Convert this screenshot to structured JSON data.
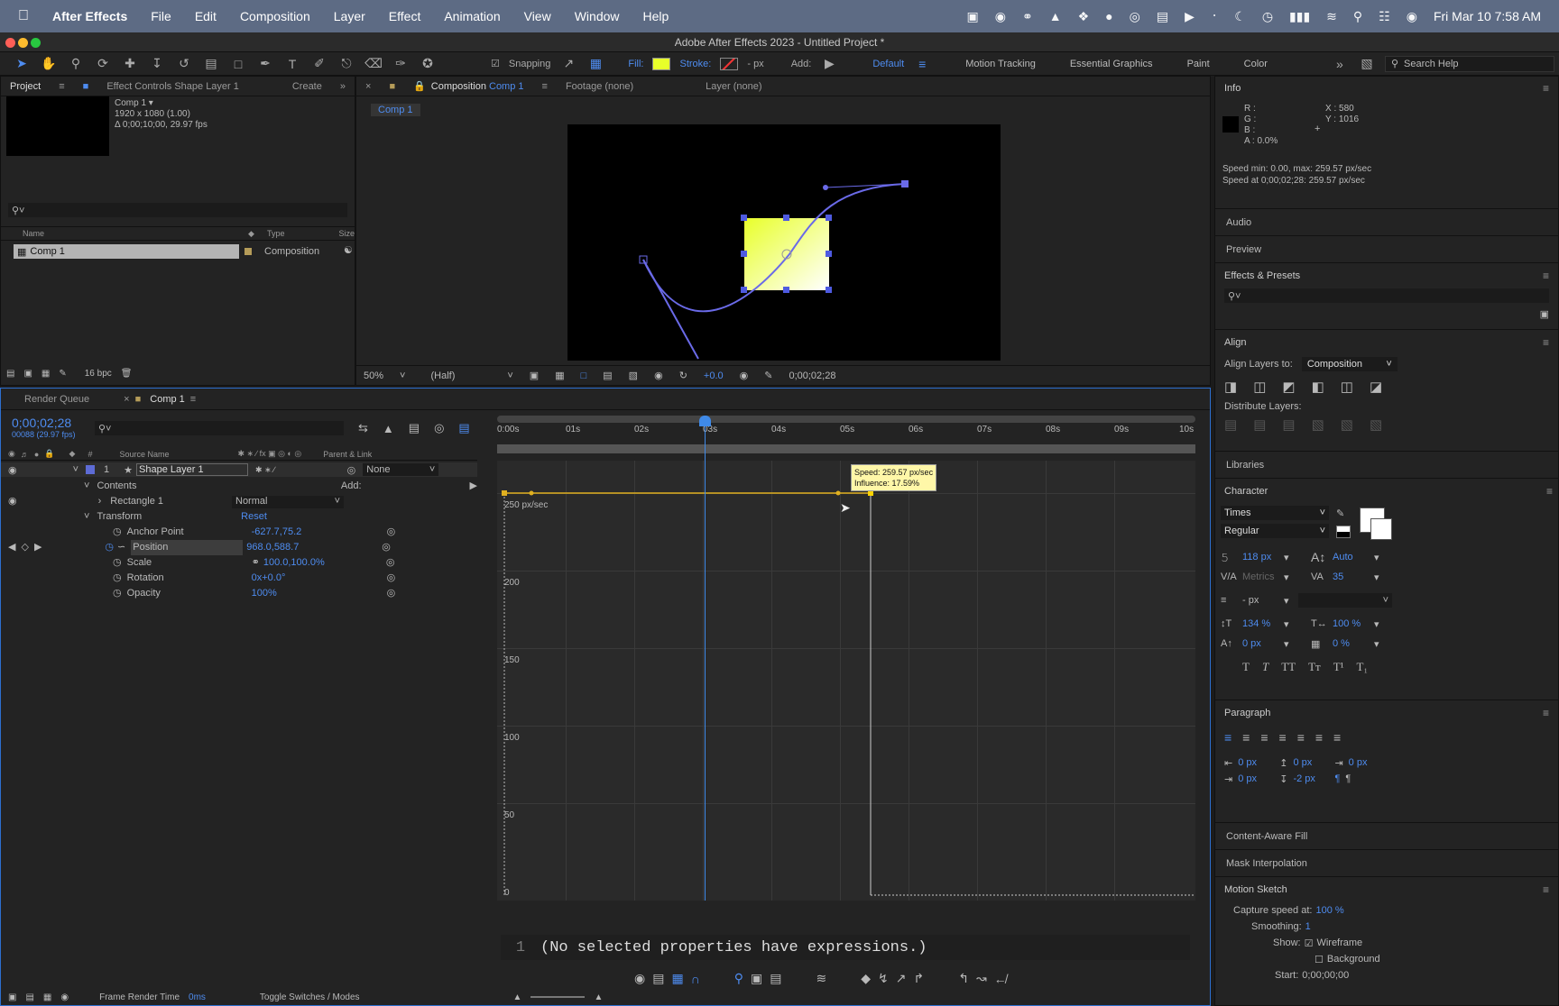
{
  "menubar": {
    "app": "After Effects",
    "items": [
      "File",
      "Edit",
      "Composition",
      "Layer",
      "Effect",
      "Animation",
      "View",
      "Window",
      "Help"
    ],
    "datetime": "Fri Mar 10  7:58 AM"
  },
  "window": {
    "title": "Adobe After Effects 2023 - Untitled Project *"
  },
  "toolbar": {
    "snapping": "Snapping",
    "fill": "Fill:",
    "stroke": "Stroke:",
    "px": "- px",
    "add": "Add:",
    "workspaces": [
      "Default",
      "Motion Tracking",
      "Essential Graphics",
      "Paint",
      "Color"
    ],
    "search_placeholder": "Search Help"
  },
  "project": {
    "tab": "Project",
    "effect_controls": "Effect Controls Shape Layer 1",
    "create": "Create",
    "comp_name": "Comp 1 ▾",
    "comp_res": "1920 x 1080 (1.00)",
    "comp_dur": "Δ 0;00;10;00, 29.97 fps",
    "cols": {
      "name": "Name",
      "type": "Type",
      "size": "Size"
    },
    "item_name": "Comp 1",
    "item_type": "Composition",
    "bpc": "16 bpc"
  },
  "viewer": {
    "tab_prefix": "Composition",
    "tab_comp": "Comp 1",
    "footage": "Footage (none)",
    "layer": "Layer (none)",
    "sub_tab": "Comp 1",
    "zoom": "50%",
    "res": "(Half)",
    "exposure": "+0.0",
    "timecode": "0;00;02;28"
  },
  "info": {
    "title": "Info",
    "r": "R :",
    "g": "G :",
    "b": "B :",
    "a": "A :  0.0%",
    "x": "X : 580",
    "y": "Y : 1016",
    "speed1": "Speed min: 0.00, max: 259.57 px/sec",
    "speed2": "Speed at 0;00;02;28: 259.57 px/sec"
  },
  "right_panels": {
    "audio": "Audio",
    "preview": "Preview",
    "effects": "Effects & Presets",
    "align": "Align",
    "align_to": "Align Layers to:",
    "align_target": "Composition",
    "distribute": "Distribute Layers:",
    "libraries": "Libraries",
    "character": "Character",
    "font": "Times",
    "style": "Regular",
    "size": "118 px",
    "leading": "Auto",
    "kerning": "Metrics",
    "tracking": "35",
    "stroke_px": "- px",
    "vscale": "134 %",
    "hscale": "100 %",
    "baseline": "0 px",
    "tsume": "0 %",
    "paragraph": "Paragraph",
    "para_vals": [
      "0 px",
      "0 px",
      "0 px",
      "0 px",
      "-2 px"
    ],
    "content_fill": "Content-Aware Fill",
    "mask_interp": "Mask Interpolation",
    "motion_sketch": "Motion Sketch",
    "capture_label": "Capture speed at:",
    "capture_val": "100 %",
    "smoothing_label": "Smoothing:",
    "smoothing_val": "1",
    "show_label": "Show:",
    "wireframe": "Wireframe",
    "background": "Background",
    "start_label": "Start:",
    "start_val": "0;00;00;00"
  },
  "timeline": {
    "render_queue": "Render Queue",
    "comp_tab": "Comp 1",
    "timecode": "0;00;02;28",
    "frame_info": "00088 (29.97 fps)",
    "cols": {
      "source": "Source Name",
      "parent": "Parent & Link"
    },
    "layer_num": "1",
    "layer_name": "Shape Layer 1",
    "parent_val": "None",
    "contents": "Contents",
    "add": "Add:",
    "rect": "Rectangle 1",
    "blend": "Normal",
    "transform": "Transform",
    "reset": "Reset",
    "props": [
      {
        "name": "Anchor Point",
        "value": "-627.7,75.2"
      },
      {
        "name": "Position",
        "value": "968.0,588.7"
      },
      {
        "name": "Scale",
        "value": "100.0,100.0%"
      },
      {
        "name": "Rotation",
        "value": "0x+0.0°"
      },
      {
        "name": "Opacity",
        "value": "100%"
      }
    ],
    "ruler": [
      "0:00s",
      "01s",
      "02s",
      "03s",
      "04s",
      "05s",
      "06s",
      "07s",
      "08s",
      "09s",
      "10s"
    ],
    "tooltip1": "Speed: 259.57 px/sec",
    "tooltip2": "Influence: 17.59%",
    "graph_unit": "250 px/sec",
    "graph_labels": [
      "200",
      "150",
      "100",
      "50",
      "0"
    ],
    "expr_line": "1",
    "expr_text": "(No selected properties have expressions.)",
    "frame_render": "Frame Render Time",
    "frame_render_val": "0ms",
    "toggle": "Toggle Switches / Modes"
  }
}
